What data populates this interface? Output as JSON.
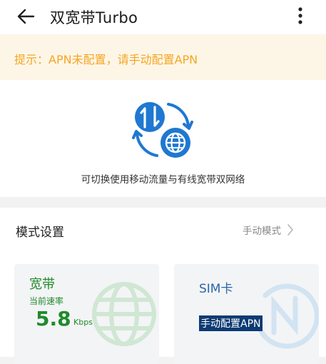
{
  "app_bar": {
    "title": "双宽带Turbo",
    "back_icon": "arrow-left-icon",
    "more_icon": "more-vertical-icon"
  },
  "banner": {
    "text": "提示：APN未配置，请手动配置APN",
    "color": "#f5a623",
    "background": "#fdf6e7"
  },
  "hero": {
    "icon": "dual-network-switch-icon",
    "description": "可切换使用移动流量与有线宽带双网络",
    "accent": "#1f78d1"
  },
  "mode_settings": {
    "title": "模式设置",
    "value": "手动模式",
    "chevron_icon": "chevron-right-icon"
  },
  "cards": {
    "broadband": {
      "title": "宽带",
      "subtitle": "当前速率",
      "speed_value": "5.8",
      "speed_unit": "Kbps",
      "icon": "globe-icon",
      "color": "#1f8a2b"
    },
    "sim": {
      "title": "SIM卡",
      "action": "手动配置APN",
      "icon": "mobile-data-icon",
      "color": "#2a66a8"
    }
  }
}
